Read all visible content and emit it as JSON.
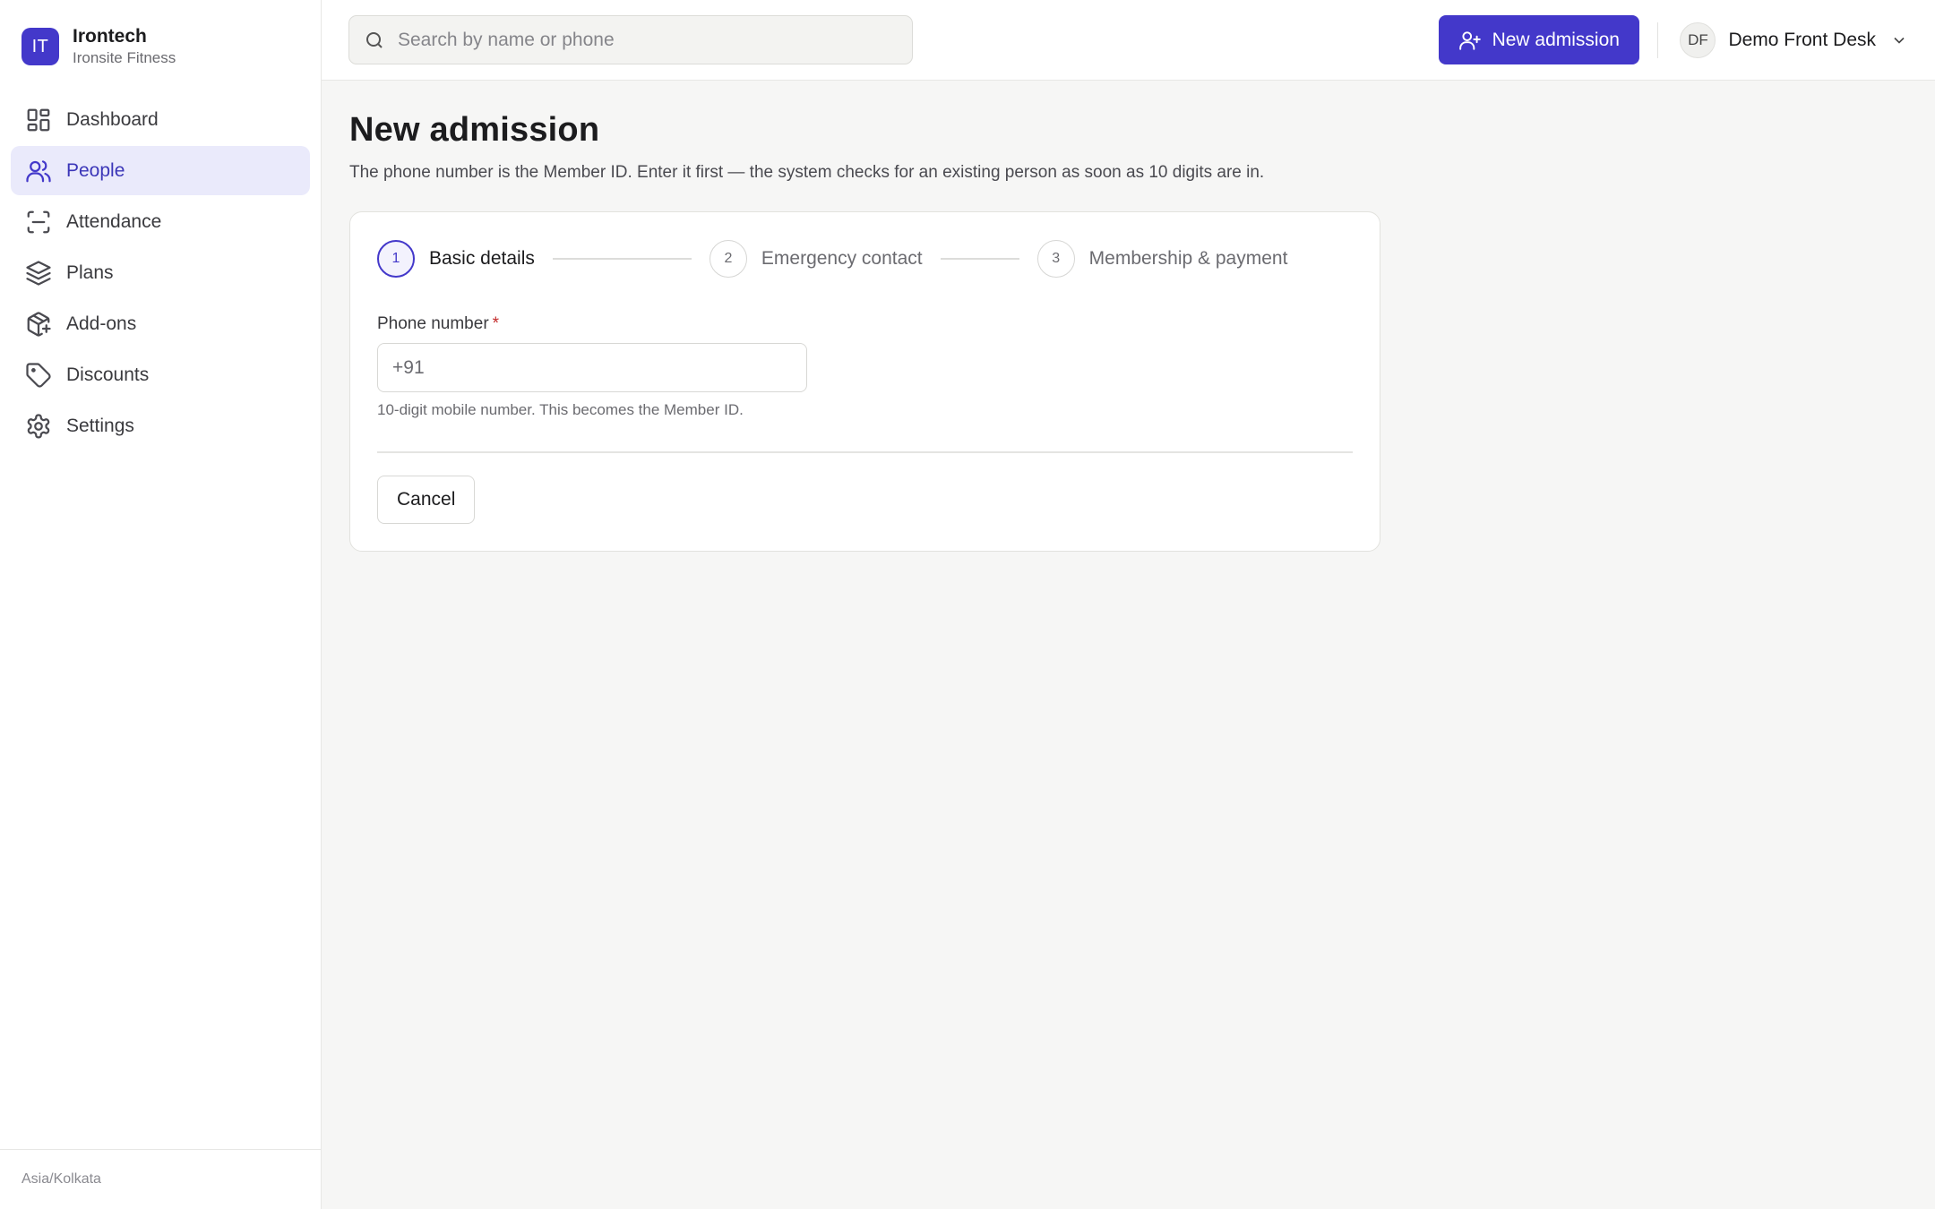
{
  "brand": {
    "logo_text": "IT",
    "name": "Irontech",
    "subtitle": "Ironsite Fitness"
  },
  "sidebar": {
    "items": [
      {
        "label": "Dashboard",
        "icon": "dashboard-icon",
        "active": false
      },
      {
        "label": "People",
        "icon": "users-icon",
        "active": true
      },
      {
        "label": "Attendance",
        "icon": "scan-icon",
        "active": false
      },
      {
        "label": "Plans",
        "icon": "layers-icon",
        "active": false
      },
      {
        "label": "Add-ons",
        "icon": "package-plus-icon",
        "active": false
      },
      {
        "label": "Discounts",
        "icon": "tag-icon",
        "active": false
      },
      {
        "label": "Settings",
        "icon": "gear-icon",
        "active": false
      }
    ],
    "footer": "Asia/Kolkata"
  },
  "topbar": {
    "search_placeholder": "Search by name or phone",
    "new_admission_label": "New admission",
    "user_initials": "DF",
    "user_name": "Demo Front Desk"
  },
  "page": {
    "title": "New admission",
    "description": "The phone number is the Member ID. Enter it first — the system checks for an existing person as soon as 10 digits are in."
  },
  "stepper": {
    "steps": [
      {
        "number": "1",
        "label": "Basic details",
        "active": true
      },
      {
        "number": "2",
        "label": "Emergency contact",
        "active": false
      },
      {
        "number": "3",
        "label": "Membership & payment",
        "active": false
      }
    ]
  },
  "form": {
    "phone_label": "Phone number",
    "required_mark": "*",
    "phone_placeholder": "+91",
    "phone_value": "",
    "phone_hint": "10-digit mobile number. This becomes the Member ID.",
    "cancel_label": "Cancel"
  },
  "colors": {
    "accent": "#4338ca",
    "active_nav_bg": "#eaeafb",
    "required": "#c42b2b"
  }
}
